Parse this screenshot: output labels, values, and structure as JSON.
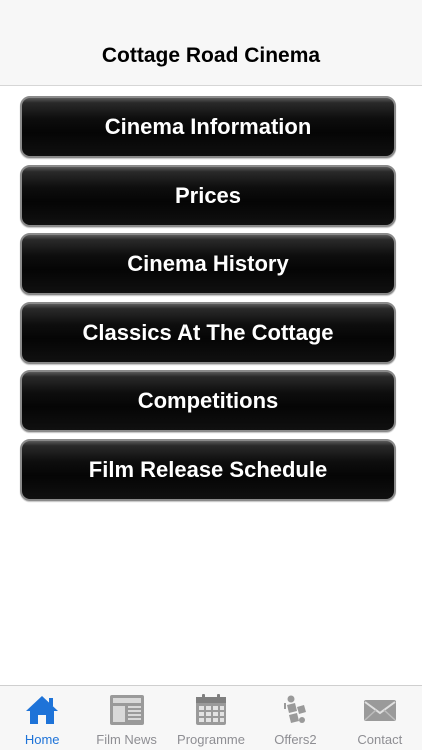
{
  "header": {
    "title": "Cottage Road Cinema"
  },
  "menu": [
    {
      "label": "Cinema Information"
    },
    {
      "label": "Prices"
    },
    {
      "label": "Cinema History"
    },
    {
      "label": "Classics At The Cottage"
    },
    {
      "label": "Competitions"
    },
    {
      "label": "Film Release Schedule"
    }
  ],
  "tabbar": {
    "active_color": "#1e73d8",
    "inactive_color": "#8e8e93",
    "tabs": [
      {
        "label": "Home",
        "icon": "home-icon",
        "active": true
      },
      {
        "label": "Film News",
        "icon": "newspaper-icon",
        "active": false
      },
      {
        "label": "Programme",
        "icon": "calendar-icon",
        "active": false
      },
      {
        "label": "Offers2",
        "icon": "offers-icon",
        "active": false
      },
      {
        "label": "Contact",
        "icon": "mail-icon",
        "active": false
      }
    ]
  }
}
